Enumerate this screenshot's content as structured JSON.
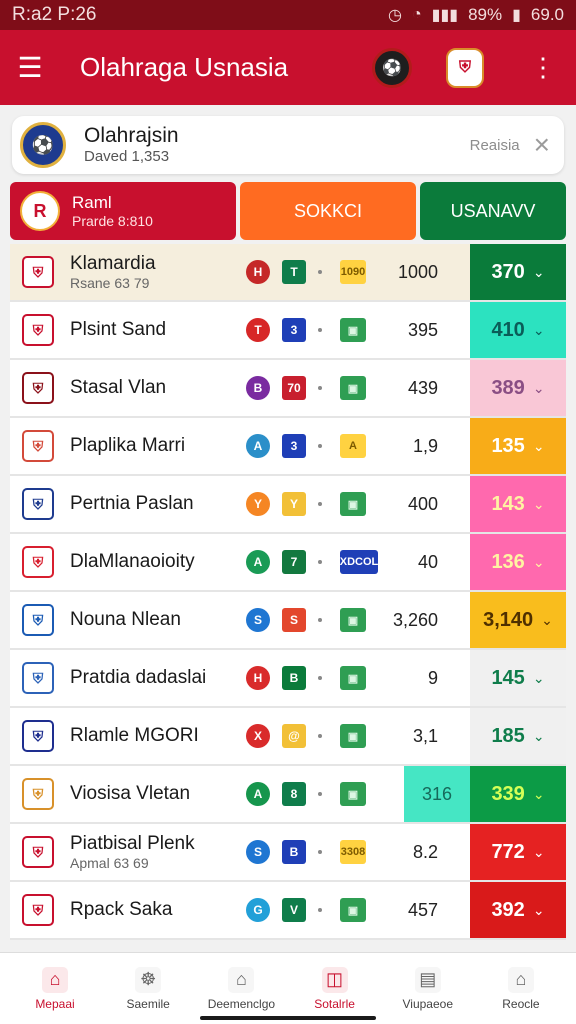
{
  "status": {
    "time": "R:a2 P:26",
    "battery": "89%",
    "signal_text": "69.0"
  },
  "appbar": {
    "title": "Olahraga Usnasia",
    "badge1": "⚽",
    "badge2": "⛨"
  },
  "search": {
    "title": "Olahrajsin",
    "subtitle": "Daved 1,353",
    "action": "Reaisia",
    "close": "×"
  },
  "tabs": {
    "primary_title": "Raml",
    "primary_subtitle": "Prarde 8:810",
    "orange": "SOKKCI",
    "green": "USANAVV"
  },
  "rows": [
    {
      "name": "Klamardia",
      "sub": "Rsane 63 79",
      "chips": [
        "H",
        "T"
      ],
      "mini": "1090",
      "value": "1000",
      "score": "370",
      "scoreClass": "score-green",
      "highlight": true
    },
    {
      "name": "Plsint Sand",
      "chips": [
        "T",
        "3"
      ],
      "mini": "",
      "value": "395",
      "score": "410",
      "scoreClass": "score-aqua"
    },
    {
      "name": "Stasal Vlan",
      "chips": [
        "B",
        "70"
      ],
      "mini": "",
      "value": "439",
      "score": "389",
      "scoreClass": "score-pink"
    },
    {
      "name": "Plaplika Marri",
      "chips": [
        "A",
        "3"
      ],
      "mini": "A",
      "value": "1,9",
      "score": "135",
      "scoreClass": "score-orange"
    },
    {
      "name": "Pertnia Paslan",
      "chips": [
        "Y",
        "Y"
      ],
      "mini": "",
      "value": "400",
      "score": "143",
      "scoreClass": "score-hotpink"
    },
    {
      "name": "DlaMlanaoioity",
      "chips": [
        "A",
        "7"
      ],
      "mini": "XDCOL",
      "value": "40",
      "score": "136",
      "scoreClass": "score-hotpink"
    },
    {
      "name": "Nouna Nlean",
      "chips": [
        "S",
        "S"
      ],
      "mini": "",
      "value": "3,260",
      "score": "3,140",
      "scoreClass": "score-yellow"
    },
    {
      "name": "Pratdia dadaslai",
      "chips": [
        "H",
        "B"
      ],
      "mini": "",
      "value": "9",
      "score": "145",
      "scoreClass": "score-white"
    },
    {
      "name": "Rlamle MGORI",
      "chips": [
        "X",
        "@"
      ],
      "mini": "",
      "value": "3,1",
      "score": "185",
      "scoreClass": "score-white"
    },
    {
      "name": "Viosisa Vletan",
      "chips": [
        "A",
        "8"
      ],
      "mini": "",
      "value": "",
      "extra": "316",
      "score": "339",
      "scoreClass": "score-greenbright"
    },
    {
      "name": "Piatbisal Plenk",
      "sub": "Apmal 63 69",
      "chips": [
        "S",
        "B"
      ],
      "mini": "3308",
      "value": "8.2",
      "score": "772",
      "scoreClass": "score-red"
    },
    {
      "name": "Rpack Saka",
      "chips": [
        "G",
        "V"
      ],
      "mini": "",
      "value": "457",
      "score": "392",
      "scoreClass": "score-red2"
    }
  ],
  "bottomnav": [
    {
      "label": "Mepaai",
      "active": true
    },
    {
      "label": "Saemile"
    },
    {
      "label": "Deemenclgo"
    },
    {
      "label": "Sotalrle",
      "active": true
    },
    {
      "label": "Viupaeoe"
    },
    {
      "label": "Reocle"
    }
  ]
}
